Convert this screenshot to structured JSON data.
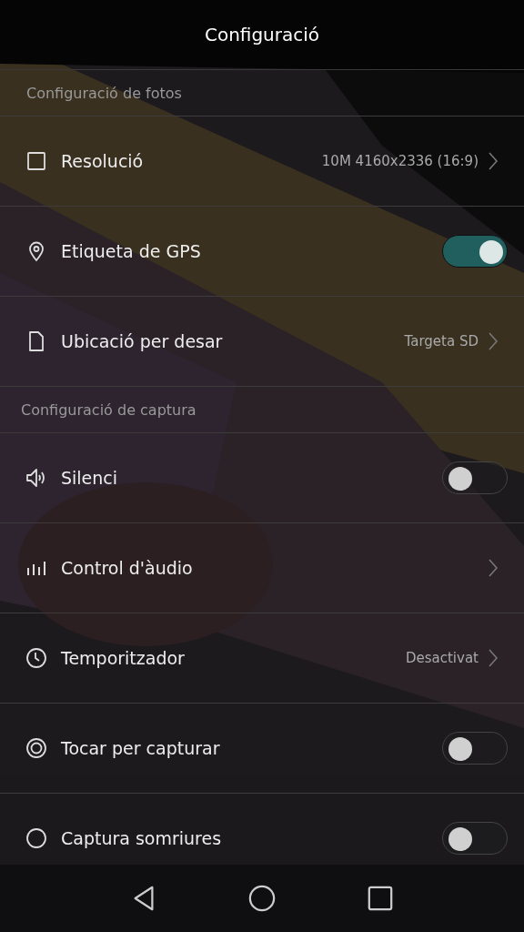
{
  "title": "Configuració",
  "sections": [
    {
      "header": "Configuració de fotos",
      "items": [
        {
          "kind": "value",
          "label": "Resolució",
          "value": "10M 4160x2336 (16:9)"
        },
        {
          "kind": "toggle",
          "label": "Etiqueta de GPS",
          "on": true
        },
        {
          "kind": "value",
          "label": "Ubicació per desar",
          "value": "Targeta SD"
        }
      ]
    },
    {
      "header": "Configuració de captura",
      "items": [
        {
          "kind": "toggle",
          "label": "Silenci",
          "on": false
        },
        {
          "kind": "link",
          "label": "Control d'àudio"
        },
        {
          "kind": "value",
          "label": "Temporitzador",
          "value": "Desactivat"
        },
        {
          "kind": "toggle",
          "label": "Tocar per capturar",
          "on": false
        },
        {
          "kind": "toggle",
          "label": "Captura somriures",
          "on": false
        }
      ]
    }
  ]
}
